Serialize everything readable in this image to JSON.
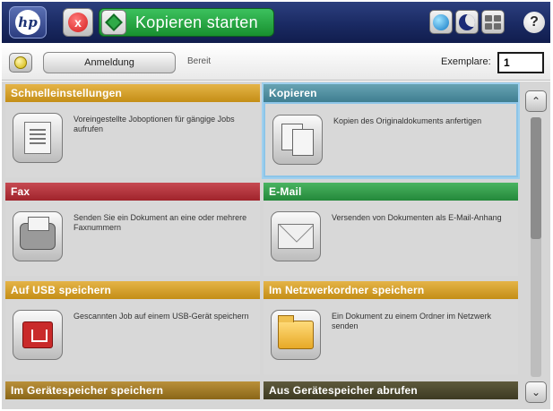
{
  "topbar": {
    "logo_text": "hp",
    "stop_icon": "x",
    "start_copy_label": "Kopieren starten",
    "help_label": "?"
  },
  "statusbar": {
    "signin_label": "Anmeldung",
    "status_text": "Bereit",
    "copies_label": "Exemplare:",
    "copies_value": "1"
  },
  "tiles": [
    {
      "title": "Schnelleinstellungen",
      "desc": "Voreingestellte Joboptionen für gängige Jobs aufrufen",
      "icon": "quick-settings-icon"
    },
    {
      "title": "Kopieren",
      "desc": "Kopien des Originaldokuments anfertigen",
      "icon": "copy-icon"
    },
    {
      "title": "Fax",
      "desc": "Senden Sie ein Dokument an eine oder mehrere Faxnummern",
      "icon": "fax-icon"
    },
    {
      "title": "E-Mail",
      "desc": "Versenden von Dokumenten als E-Mail-Anhang",
      "icon": "email-icon"
    },
    {
      "title": "Auf USB speichern",
      "desc": "Gescannten Job auf einem USB-Gerät speichern",
      "icon": "usb-icon"
    },
    {
      "title": "Im Netzwerkordner speichern",
      "desc": "Ein Dokument zu einem Ordner im Netzwerk senden",
      "icon": "network-folder-icon"
    },
    {
      "title": "Im Gerätespeicher speichern"
    },
    {
      "title": "Aus Gerätespeicher abrufen"
    }
  ],
  "scroll": {
    "up": "⌃",
    "down": "⌄"
  },
  "colors": {
    "topbar": "#1a2a63",
    "start_green": "#23883a",
    "gold": "#c48e16",
    "teal": "#3f7e90",
    "fax_red": "#a0232b",
    "email_green": "#23883a",
    "olive": "#8a6618",
    "dark_olive": "#3d3a22",
    "selected_outline": "#9fd0ee"
  }
}
